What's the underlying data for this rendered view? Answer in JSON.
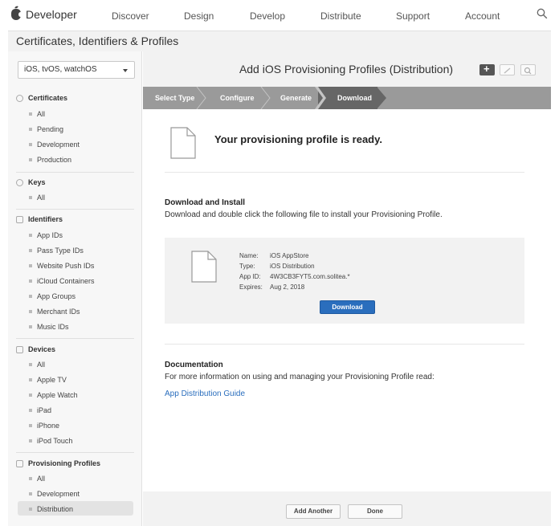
{
  "nav": {
    "brand": "Developer",
    "items": [
      "Discover",
      "Design",
      "Develop",
      "Distribute",
      "Support",
      "Account"
    ]
  },
  "header": {
    "title": "Certificates, Identifiers & Profiles"
  },
  "sidebar": {
    "platform": "iOS, tvOS, watchOS",
    "sections": [
      {
        "title": "Certificates",
        "items": [
          "All",
          "Pending",
          "Development",
          "Production"
        ]
      },
      {
        "title": "Keys",
        "items": [
          "All"
        ]
      },
      {
        "title": "Identifiers",
        "items": [
          "App IDs",
          "Pass Type IDs",
          "Website Push IDs",
          "iCloud Containers",
          "App Groups",
          "Merchant IDs",
          "Music IDs"
        ]
      },
      {
        "title": "Devices",
        "items": [
          "All",
          "Apple TV",
          "Apple Watch",
          "iPad",
          "iPhone",
          "iPod Touch"
        ]
      },
      {
        "title": "Provisioning Profiles",
        "items": [
          "All",
          "Development",
          "Distribution"
        ]
      }
    ]
  },
  "main": {
    "title": "Add iOS Provisioning Profiles (Distribution)",
    "steps": [
      "Select Type",
      "Configure",
      "Generate",
      "Download"
    ],
    "active_step": "Download",
    "ready": "Your provisioning profile is ready.",
    "download_title": "Download and Install",
    "download_text": "Download and double click the following file to install your Provisioning Profile.",
    "profile": {
      "name_label": "Name:",
      "name": "iOS AppStore",
      "type_label": "Type:",
      "type": "iOS Distribution",
      "appid_label": "App ID:",
      "appid": "4W3CB3FYT5.com.solitea.*",
      "expires_label": "Expires:",
      "expires": "Aug 2, 2018"
    },
    "download_button": "Download",
    "doc_title": "Documentation",
    "doc_text": "For more information on using and managing your Provisioning Profile read:",
    "doc_link": "App Distribution Guide"
  },
  "footer": {
    "add_another": "Add Another",
    "done": "Done"
  },
  "colors": {
    "accent": "#2a6ebd",
    "step_bar": "#9a9a9a",
    "step_active": "#666666"
  }
}
